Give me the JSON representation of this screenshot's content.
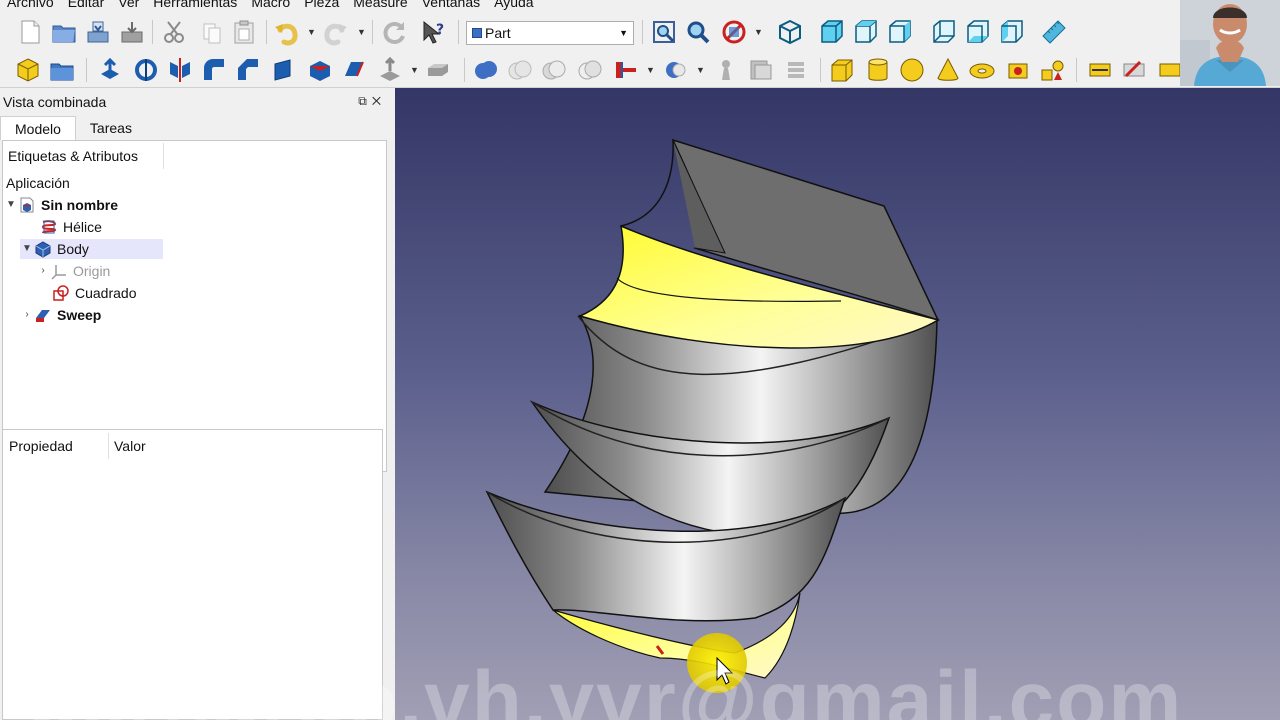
{
  "menu": [
    "Archivo",
    "Editar",
    "Ver",
    "Herramientas",
    "Macro",
    "Pieza",
    "Measure",
    "Ventanas",
    "Ayuda"
  ],
  "workbench": {
    "selected": "Part"
  },
  "combo": {
    "title": "Vista combinada",
    "tabs": [
      "Modelo",
      "Tareas"
    ],
    "tree_header": "Etiquetas & Atributos",
    "tree": {
      "root": "Aplicación",
      "document": "Sin nombre",
      "items": [
        "Hélice",
        "Body",
        "Origin",
        "Cuadrado",
        "Sweep"
      ]
    },
    "property_headers": [
      "Propiedad",
      "Valor"
    ]
  },
  "watermark": "bernardo.vh.yvr@gmail.com",
  "colors": {
    "viewport_top": "#343765",
    "viewport_bottom": "#a19fb4",
    "selection": "#e5e5fb",
    "highlight_face": "#ffff60"
  }
}
